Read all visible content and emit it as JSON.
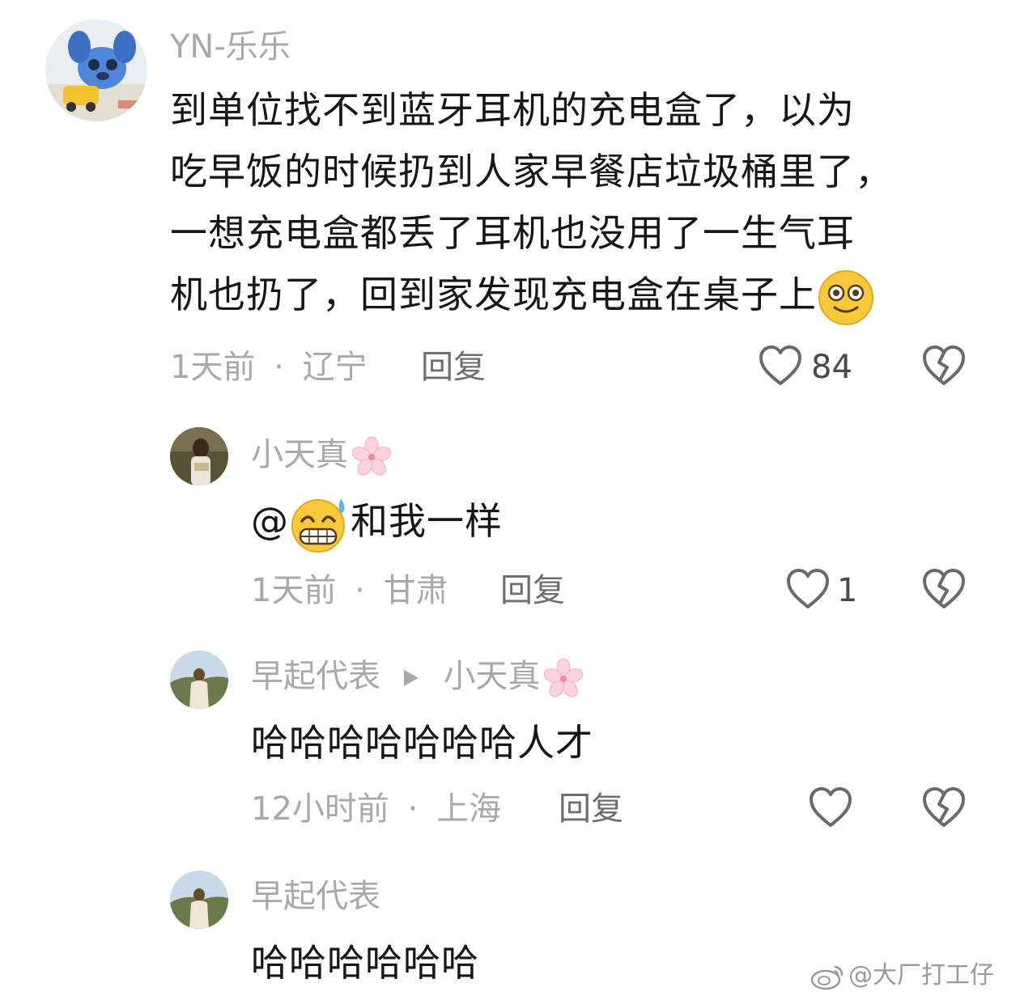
{
  "comments": [
    {
      "username": "YN-乐乐",
      "text_lines": [
        "到单位找不到蓝牙耳机的充电盒了，以为",
        "吃早饭的时候扔到人家早餐店垃圾桶里了，",
        "一想充电盒都丢了耳机也没用了一生气耳",
        "机也扔了，回到家发现充电盒在桌子上"
      ],
      "trailing_emoji": "dizzy-face-emoji",
      "time": "1天前",
      "location": "辽宁",
      "separator": "·",
      "reply_label": "回复",
      "like_count": "84"
    },
    {
      "username": "小天真",
      "username_badge": "sakura-emoji",
      "text_prefix": "@",
      "emoji": "sweat-grin-emoji",
      "text": "和我一样",
      "time": "1天前",
      "location": "甘肃",
      "separator": "·",
      "reply_label": "回复",
      "like_count": "1"
    },
    {
      "username": "早起代表",
      "reply_to": "小天真",
      "reply_to_badge": "sakura-emoji",
      "text": "哈哈哈哈哈哈哈人才",
      "time": "12小时前",
      "location": "上海",
      "separator": "·",
      "reply_label": "回复",
      "like_count": ""
    },
    {
      "username": "早起代表",
      "text": "哈哈哈哈哈哈"
    }
  ],
  "watermark": "@大厂打工仔",
  "icons": [
    "heart-outline-icon",
    "broken-heart-icon",
    "play-triangle-icon",
    "weibo-logo-icon"
  ],
  "colors": {
    "text": "#161616",
    "muted": "#a9a9ad",
    "reply": "#6d6d72",
    "icon": "#6a6a6e"
  }
}
